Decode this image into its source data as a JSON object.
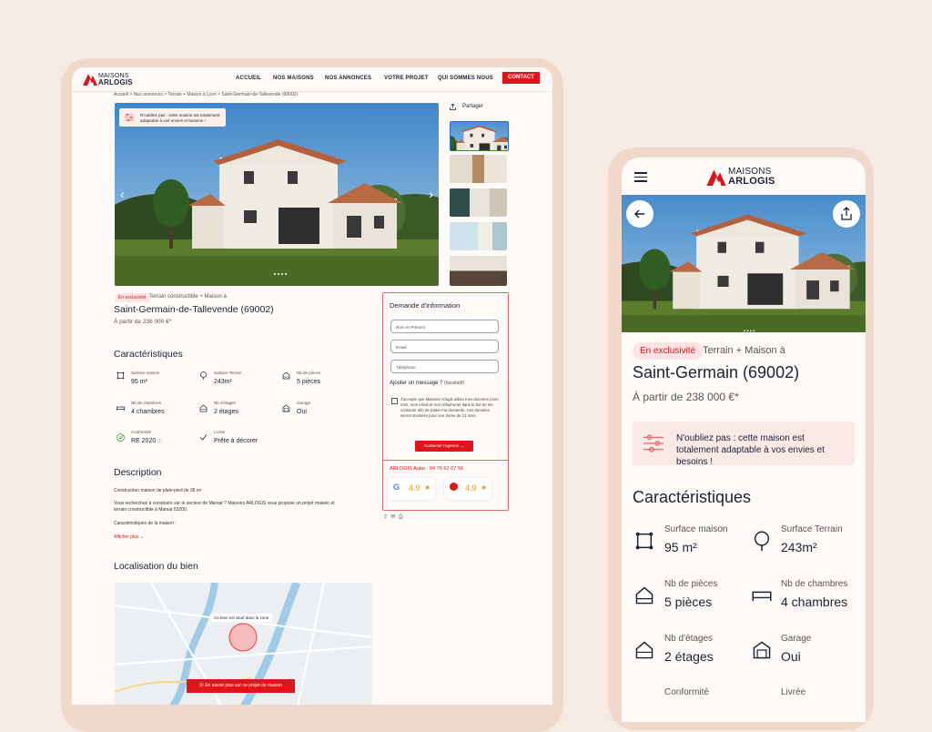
{
  "brand": {
    "line1": "MAISONS",
    "line2": "ARLOGIS",
    "accent": "#e0141a"
  },
  "desktop": {
    "nav": [
      {
        "label": "ACCUEIL"
      },
      {
        "label": "NOS MAISONS"
      },
      {
        "label": "NOS ANNONCES"
      },
      {
        "label": "VOTRE PROJET"
      },
      {
        "label": "QUI SOMMES NOUS"
      }
    ],
    "contact_label": "CONTACT",
    "breadcrumb": "Accueil  >  Nos annonces  >  Terrain + Maison à Lyon  >  Saint-Germain-de-Tallevende (69002)",
    "share_label": "Partager",
    "hero_note": "N'oubliez pas : cette maison est totalement adaptable à vos envies et besoins !",
    "exclusive": "En exclusivité",
    "subtitle": "Terrain constructible + Maison à",
    "title": "Saint-Germain-de-Tallevende (69002)",
    "price": "À partir de 238 000 €*",
    "features_title": "Caractéristiques",
    "features": [
      {
        "label": "Surface maison",
        "value": "95 m²",
        "icon": "frame-icon"
      },
      {
        "label": "Surface Terrain",
        "value": "243m²",
        "icon": "tree-icon"
      },
      {
        "label": "Nb de pièces",
        "value": "5 pièces",
        "icon": "house-icon"
      },
      {
        "label": "Nb de chambres",
        "value": "4 chambres",
        "icon": "bed-icon"
      },
      {
        "label": "Nb d'étages",
        "value": "2 étages",
        "icon": "floors-icon"
      },
      {
        "label": "Garage",
        "value": "Oui",
        "icon": "garage-icon"
      },
      {
        "label": "Conformité",
        "value": "RE 2020",
        "icon": "leaf-icon"
      },
      {
        "label": "Livrée",
        "value": "Prête à décorer",
        "icon": "check-icon"
      }
    ],
    "description_title": "Description",
    "description": [
      "Construction maison de plain-pied de 95 m²",
      "Vous recherchez à construire sur le secteur de Marsat ? Maisons ARLOGIS vous propose un projet maison et terrain constructible à Marsat 63200.",
      "Caractéristiques de la maison :"
    ],
    "show_more": "Afficher plus",
    "location_title": "Localisation du bien",
    "map_tooltip": "Ce bien est situé dans la zone",
    "map_button": "En savoir plus sur ce projet de maison",
    "form": {
      "title": "Demande d'information",
      "name_placeholder": "Nom et Prénom",
      "email_placeholder": "Email",
      "phone_placeholder": "Téléphone",
      "message_label": "Ajouter un message ?",
      "optional": "(facultatif)",
      "consent": "J'accepte que Maisons Arlogis utilise mes données (mon nom, mon email et mon téléphone) dans le but de me contacter afin de traiter ma demande. Ces données seront stockées pour une durée de 12 mois.",
      "submit": "Contacter l'agence",
      "agency": "ARLOGIS Aube : 04 76 62 07 56",
      "ratings": [
        {
          "score": "4.9",
          "icon": "google-icon"
        },
        {
          "score": "4.9",
          "icon": "review-icon"
        }
      ]
    }
  },
  "mobile": {
    "exclusive": "En exclusivité",
    "subtitle": "Terrain + Maison à",
    "title": "Saint-Germain (69002)",
    "price": "À partir de 238 000 €*",
    "note": "N'oubliez pas : cette maison est totalement adaptable à vos envies et besoins !",
    "features_title": "Caractéristiques",
    "features": [
      {
        "label": "Surface maison",
        "value": "95 m²"
      },
      {
        "label": "Surface Terrain",
        "value": "243m²"
      },
      {
        "label": "Nb de pièces",
        "value": "5 pièces"
      },
      {
        "label": "Nb de chambres",
        "value": "4 chambres"
      },
      {
        "label": "Nb d'étages",
        "value": "2 étages"
      },
      {
        "label": "Garage",
        "value": "Oui"
      },
      {
        "label": "Conformité",
        "value": ""
      },
      {
        "label": "Livrée",
        "value": ""
      }
    ]
  }
}
